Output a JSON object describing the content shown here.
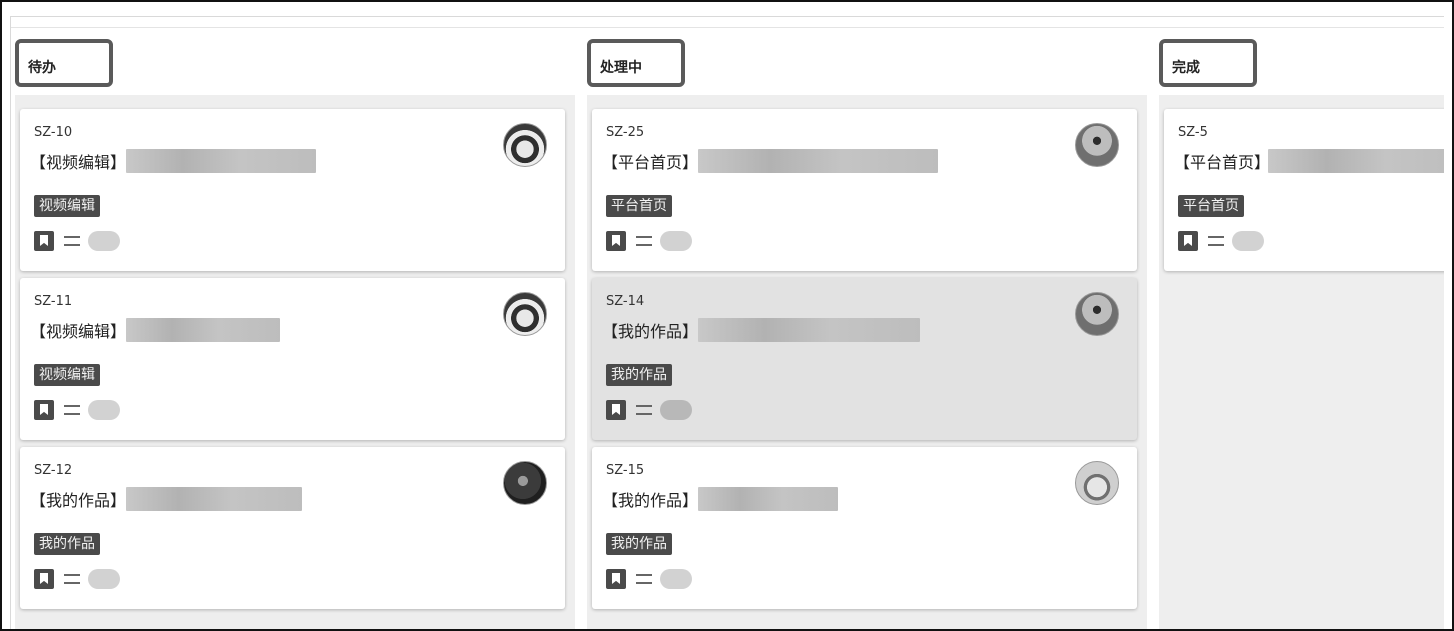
{
  "columns": [
    {
      "title": "待办",
      "cards": [
        {
          "id": "SZ-10",
          "title_prefix": "【视频编辑】",
          "tag": "视频编辑"
        },
        {
          "id": "SZ-11",
          "title_prefix": "【视频编辑】",
          "tag": "视频编辑"
        },
        {
          "id": "SZ-12",
          "title_prefix": "【我的作品】",
          "tag": "我的作品"
        }
      ]
    },
    {
      "title": "处理中",
      "cards": [
        {
          "id": "SZ-25",
          "title_prefix": "【平台首页】",
          "tag": "平台首页"
        },
        {
          "id": "SZ-14",
          "title_prefix": "【我的作品】",
          "tag": "我的作品",
          "selected": true
        },
        {
          "id": "SZ-15",
          "title_prefix": "【我的作品】",
          "tag": "我的作品"
        }
      ]
    },
    {
      "title": "完成",
      "cards": [
        {
          "id": "SZ-5",
          "title_prefix": "【平台首页】",
          "tag": "平台首页"
        }
      ]
    }
  ],
  "icons": {
    "bookmark": "bookmark-icon",
    "priority": "priority-medium-icon",
    "estimate": "estimate-pill"
  }
}
